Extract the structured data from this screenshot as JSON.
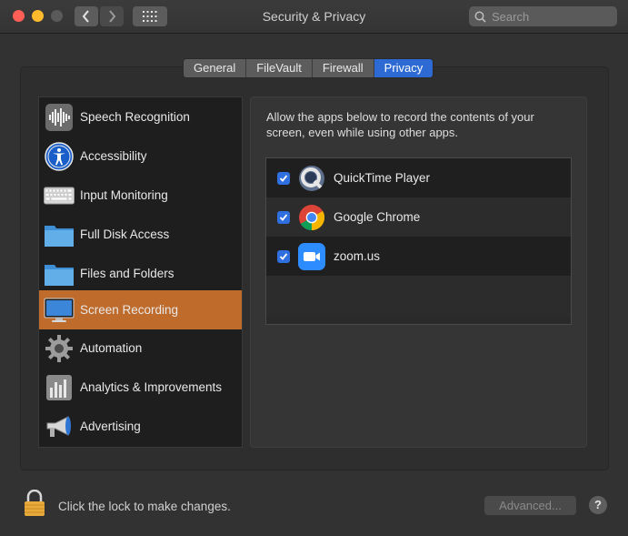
{
  "window": {
    "title": "Security & Privacy",
    "search_placeholder": "Search"
  },
  "tabs": [
    {
      "label": "General",
      "active": false
    },
    {
      "label": "FileVault",
      "active": false
    },
    {
      "label": "Firewall",
      "active": false
    },
    {
      "label": "Privacy",
      "active": true
    }
  ],
  "sidebar": {
    "items": [
      {
        "label": "Speech Recognition",
        "icon": "waveform-icon"
      },
      {
        "label": "Accessibility",
        "icon": "accessibility-icon"
      },
      {
        "label": "Input Monitoring",
        "icon": "keyboard-icon"
      },
      {
        "label": "Full Disk Access",
        "icon": "folder-icon"
      },
      {
        "label": "Files and Folders",
        "icon": "folder-icon"
      },
      {
        "label": "Screen Recording",
        "icon": "display-icon",
        "selected": true
      },
      {
        "label": "Automation",
        "icon": "gear-icon"
      },
      {
        "label": "Analytics & Improvements",
        "icon": "bar-chart-icon"
      },
      {
        "label": "Advertising",
        "icon": "megaphone-icon"
      }
    ]
  },
  "main": {
    "description": "Allow the apps below to record the contents of your screen, even while using other apps.",
    "apps": [
      {
        "label": "QuickTime Player",
        "checked": true,
        "icon": "quicktime-icon"
      },
      {
        "label": "Google Chrome",
        "checked": true,
        "icon": "chrome-icon"
      },
      {
        "label": "zoom.us",
        "checked": true,
        "icon": "zoom-icon"
      }
    ]
  },
  "footer": {
    "lock_text": "Click the lock to make changes.",
    "advanced_label": "Advanced...",
    "help_label": "?"
  },
  "colors": {
    "accent": "#2d6ad3",
    "selected_row": "#bf6b2b"
  }
}
